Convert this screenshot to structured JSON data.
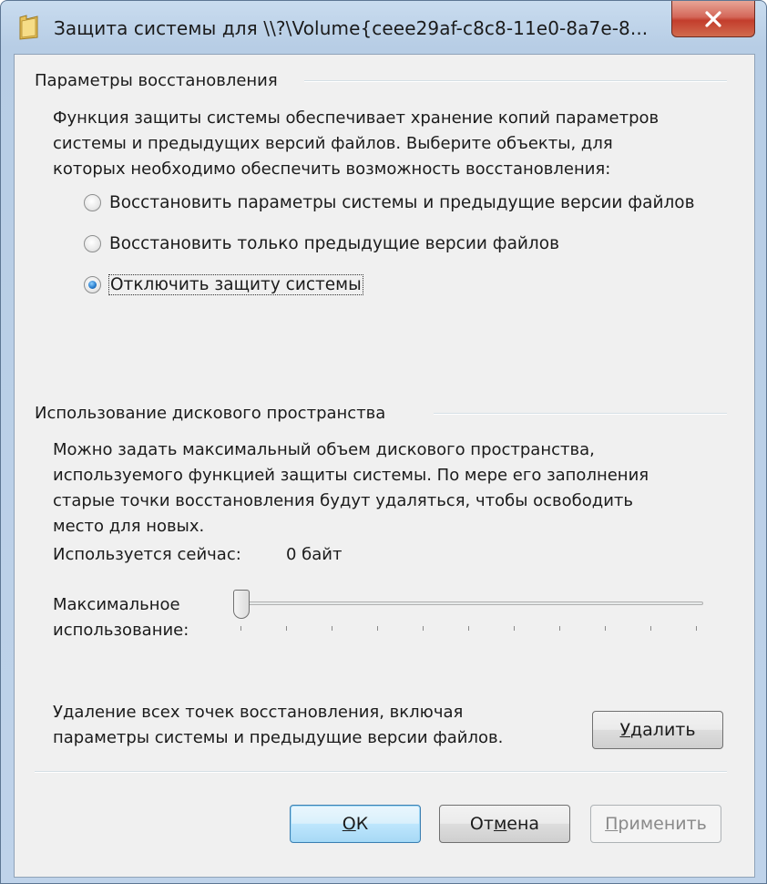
{
  "window": {
    "title": "Защита системы для \\\\?\\Volume{ceee29af-c8c8-11e0-8a7e-8...",
    "close_glyph": "✕"
  },
  "restore_settings": {
    "group_label": "Параметры восстановления",
    "description_lines": [
      "Функция защиты системы обеспечивает хранение копий параметров",
      "системы и предыдущих версий файлов. Выберите объекты, для",
      "которых необходимо обеспечить возможность восстановления:"
    ],
    "options": [
      {
        "label": "Восстановить параметры системы и предыдущие версии файлов",
        "checked": false
      },
      {
        "label": "Восстановить только предыдущие версии файлов",
        "checked": false
      },
      {
        "label": "Отключить защиту системы",
        "checked": true
      }
    ]
  },
  "disk_usage": {
    "group_label": "Использование дискового пространства",
    "description_lines": [
      "Можно задать максимальный объем дискового пространства,",
      "используемого функцией защиты системы. По мере его заполнения",
      "старые точки восстановления будут удаляться, чтобы освободить",
      "место для новых."
    ],
    "current_usage_label": "Используется сейчас:",
    "current_usage_value": "0 байт",
    "max_usage_label_line1": "Максимальное",
    "max_usage_label_line2": "использование:",
    "slider_value_fraction": 0
  },
  "delete_section": {
    "text_line1": "Удаление всех точек восстановления, включая",
    "text_line2": "параметры системы и предыдущие версии файлов.",
    "delete_button": {
      "text": "Удалить",
      "mnemonic": "У",
      "rest": "далить"
    }
  },
  "footer": {
    "ok_button": {
      "text": "ОК",
      "mnemonic": "О",
      "rest": "К"
    },
    "cancel_button": {
      "text": "Отмена",
      "prefix": "От",
      "mnemonic": "м",
      "rest": "ена"
    },
    "apply_button": {
      "text": "Применить",
      "mnemonic": "П",
      "rest": "рименить",
      "enabled": false
    }
  }
}
